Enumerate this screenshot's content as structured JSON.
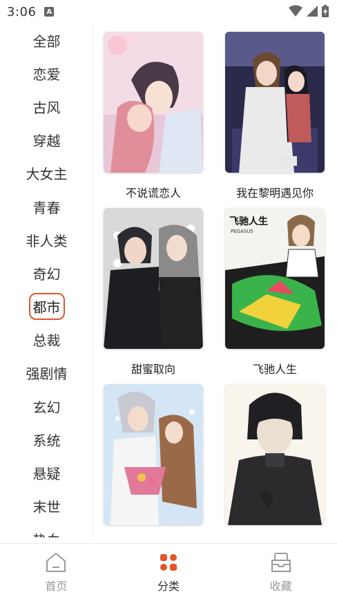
{
  "status": {
    "time": "3:06",
    "icon_left": "A"
  },
  "categories": [
    "全部",
    "恋爱",
    "古风",
    "穿越",
    "大女主",
    "青春",
    "非人类",
    "奇幻",
    "都市",
    "总裁",
    "强剧情",
    "玄幻",
    "系统",
    "悬疑",
    "末世",
    "热血"
  ],
  "active_category": "都市",
  "comics": [
    {
      "title": "不说谎恋人"
    },
    {
      "title": "我在黎明遇见你"
    },
    {
      "title": "甜蜜取向"
    },
    {
      "title": "飞驰人生"
    },
    {
      "title": ""
    },
    {
      "title": ""
    }
  ],
  "cover_texts": {
    "comic4_logo": "飞驰人生",
    "comic4_sub": "PEGASUS"
  },
  "nav": {
    "home": "首页",
    "category": "分类",
    "favorites": "收藏"
  },
  "colors": {
    "accent": "#e3552a",
    "inactive": "#999999"
  }
}
